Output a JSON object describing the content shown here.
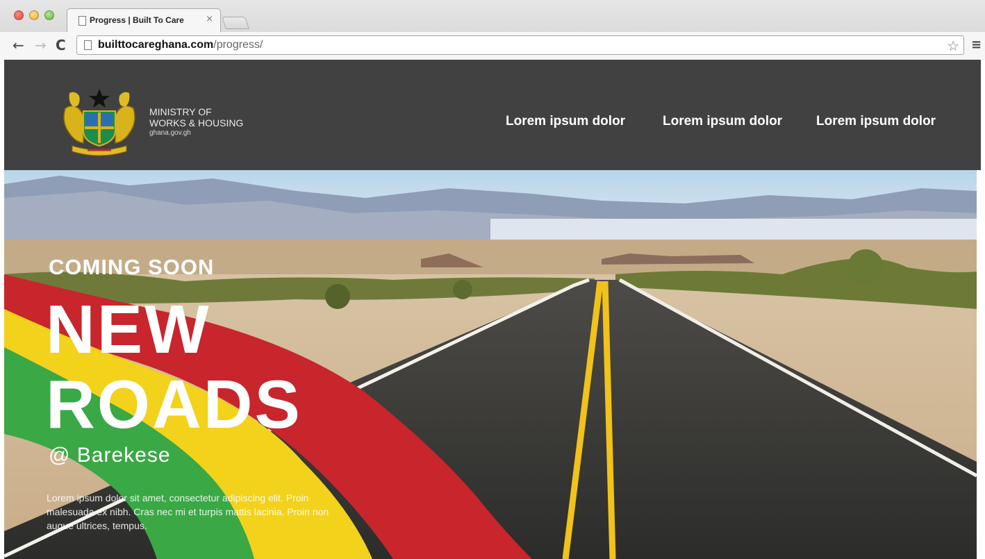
{
  "browser": {
    "tab_title": "Progress | Built To Care",
    "tab_close": "×",
    "url_domain": "builttocareghana.com",
    "url_path": "/progress/",
    "back": "←",
    "forward": "→",
    "reload": "C",
    "star": "☆",
    "menu": "≡"
  },
  "header": {
    "logo_icon": "ghana-coat-of-arms-icon",
    "ministry_line1": "MINISTRY OF",
    "ministry_line2": "WORKS & HOUSING",
    "ministry_url": "ghana.gov.gh",
    "nav": [
      {
        "label": "Lorem ipsum dolor"
      },
      {
        "label": "Lorem ipsum dolor"
      },
      {
        "label": "Lorem ipsum dolor"
      }
    ]
  },
  "hero": {
    "kicker": "COMING SOON",
    "headline_1": "NEW",
    "headline_2": "ROADS",
    "location": "@ Barekese",
    "description": "Lorem ipsum dolor sit amet, consectetur adipiscing elit. Proin malesuada ex nibh. Cras nec mi et turpis mattis lacinia. Proin non augue ultrices, tempus."
  },
  "colors": {
    "header_bg": "#424141",
    "flag_red": "#c8252c",
    "flag_yellow": "#f2d21b",
    "flag_green": "#3aa845",
    "road_line": "#f1c21a"
  }
}
